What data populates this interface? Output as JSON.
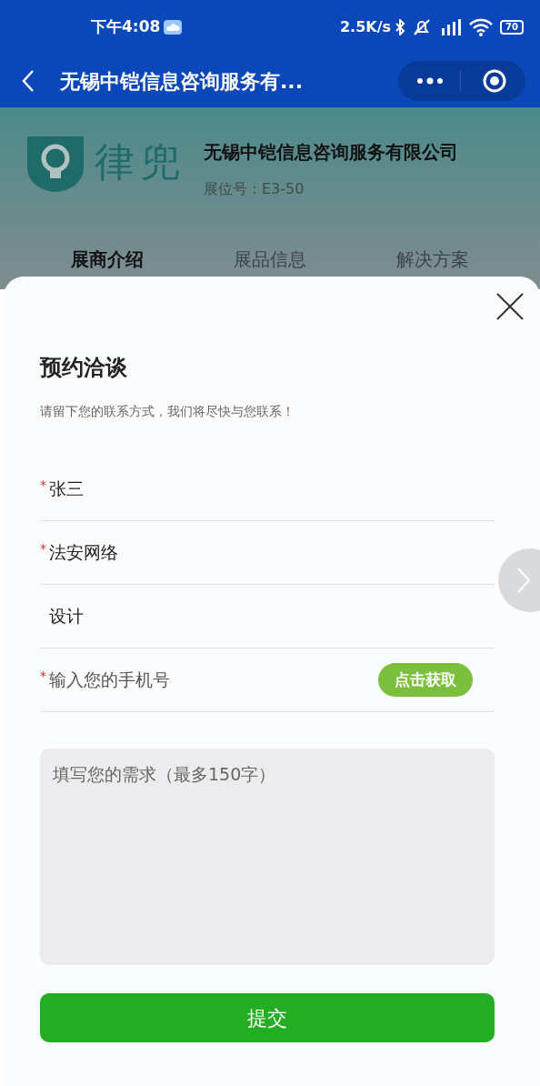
{
  "status_bar": {
    "time": "下午4:08",
    "speed": "2.5K/s",
    "battery": "70"
  },
  "nav": {
    "title": "无锡中铠信息咨询服务有..."
  },
  "exhibitor": {
    "logo_text": "律兜",
    "name": "无锡中铠信息咨询服务有限公司",
    "booth": "展位号：E3-50"
  },
  "tabs": [
    {
      "label": "展商介绍",
      "selected": true
    },
    {
      "label": "展品信息",
      "selected": false
    },
    {
      "label": "解决方案",
      "selected": false
    }
  ],
  "dialog": {
    "title": "预约洽谈",
    "subtitle": "请留下您的联系方式，我们将尽快与您联系！",
    "fields": [
      {
        "value": "张三",
        "required_mark": "*"
      },
      {
        "value": "法安网络",
        "required_mark": "*"
      },
      {
        "value": "设计"
      },
      {
        "placeholder": "输入您的手机号",
        "required_mark": "*",
        "button": "点击获取"
      }
    ],
    "textarea": {
      "placeholder": "填写您的需求（最多150字）"
    },
    "submit": "提交"
  }
}
